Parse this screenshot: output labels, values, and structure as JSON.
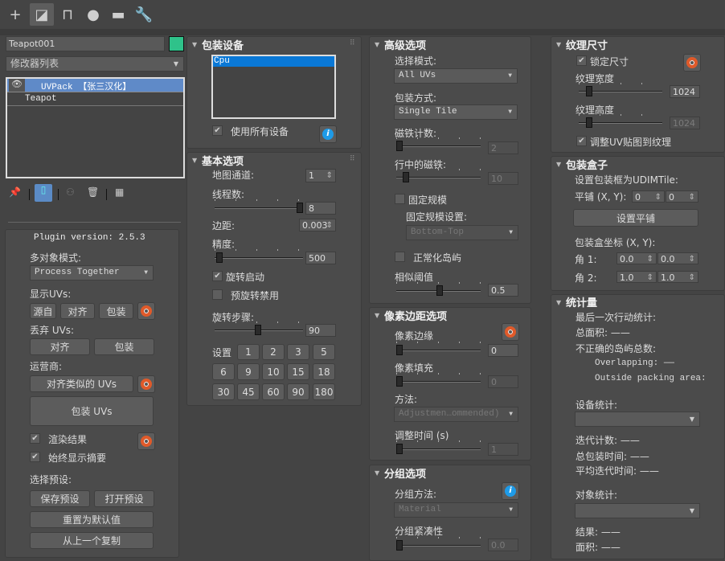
{
  "toolbar": {
    "icons": [
      "plus-icon",
      "modify-icon",
      "hierarchy-icon",
      "motion-icon",
      "display-icon",
      "utilities-icon"
    ],
    "active": "modify"
  },
  "object": {
    "name": "Teapot001",
    "color": "#2fc28a"
  },
  "modifier_list": {
    "label": "修改器列表"
  },
  "stack": [
    {
      "label": "UVPack 【张三汉化】",
      "selected": true
    },
    {
      "label": "Teapot",
      "selected": false
    }
  ],
  "plugin": {
    "version": "Plugin version: 2.5.3",
    "multi_mode_label": "多对象模式:",
    "multi_mode_value": "Process Together",
    "show_uvs_label": "显示UVs:",
    "show_buttons": [
      "源自",
      "对齐",
      "包装"
    ],
    "discard_label": "丢弃 UVs:",
    "discard_buttons": [
      "对齐",
      "包装"
    ],
    "operators_label": "运营商:",
    "align_similar": "对齐类似的 UVs",
    "pack_uvs": "包装 UVs",
    "render_result": "渲染结果",
    "always_summary": "始终显示摘要",
    "preset_label": "选择预设:",
    "save_preset": "保存预设",
    "open_preset": "打开预设",
    "reset_default": "重置为默认值",
    "copy_prev": "从上一个复制"
  },
  "devices": {
    "title": "包装设备",
    "items": [
      "Cpu"
    ],
    "use_all": "使用所有设备"
  },
  "basic": {
    "title": "基本选项",
    "map_channel_label": "地图通道:",
    "map_channel": "1",
    "threads_label": "线程数:",
    "threads": "8",
    "margin_label": "边距:",
    "margin": "0.003",
    "precision_label": "精度:",
    "precision": "500",
    "rotation_enable": "旋转启动",
    "prerotate_disable": "预旋转禁用",
    "rotation_step_label": "旋转步骤:",
    "rotation_step": "90",
    "set_label": "设置",
    "presets": [
      "1",
      "2",
      "3",
      "5",
      "6",
      "9",
      "10",
      "15",
      "18",
      "30",
      "45",
      "60",
      "90",
      "180"
    ]
  },
  "advanced": {
    "title": "高级选项",
    "select_mode_label": "选择模式:",
    "select_mode": "All UVs",
    "pack_mode_label": "包装方式:",
    "pack_mode": "Single Tile",
    "tile_count_label": "磁铁计数:",
    "tile_count": "2",
    "tiles_in_row_label": "行中的磁铁:",
    "tiles_in_row": "10",
    "fixed_scale": "固定规模",
    "fixed_scale_settings": "固定规模设置:",
    "fixed_scale_value": "Bottom-Top",
    "normalize": "正常化岛屿",
    "similarity_label": "相似阈值",
    "similarity": "0.5"
  },
  "pixel": {
    "title": "像素边距选项",
    "edge_label": "像素边缘",
    "edge": "0",
    "fill_label": "像素填充",
    "fill": "0",
    "method_label": "方法:",
    "method": "Adjustmen…ommended)",
    "adjust_time_label": "调整时间 (s)",
    "adjust_time": "1"
  },
  "grouping": {
    "title": "分组选项",
    "method_label": "分组方法:",
    "method": "Material",
    "compact_label": "分组紧凑性",
    "compact": "0.0"
  },
  "texture": {
    "title": "纹理尺寸",
    "lock": "锁定尺寸",
    "width_label": "纹理宽度",
    "width": "1024",
    "height_label": "纹理高度",
    "height": "1024",
    "fit": "调整UV贴图到纹理"
  },
  "box": {
    "title": "包装盒子",
    "udim_label": "设置包装框为UDIMTile:",
    "tile_label": "平铺 (X, Y):",
    "tile_x": "0",
    "tile_y": "0",
    "set_tile": "设置平铺",
    "coords_label": "包装盒坐标 (X, Y):",
    "corner1_label": "角 1:",
    "c1x": "0.0",
    "c1y": "0.0",
    "corner2_label": "角 2:",
    "c2x": "1.0",
    "c2y": "1.0"
  },
  "stats": {
    "title": "统计量",
    "last_action": "最后一次行动统计:",
    "total_area": "总面积: ——",
    "invalid": "不正确的岛屿总数:",
    "overlapping": "Overlapping: ——",
    "outside": "Outside packing area:",
    "device_stats": "设备统计:",
    "iterations": "迭代计数: ——",
    "total_time": "总包装时间: ——",
    "avg_time": "平均迭代时间: ——",
    "object_stats": "对象统计:",
    "result": "结果: ——",
    "area": "面积: ——"
  }
}
